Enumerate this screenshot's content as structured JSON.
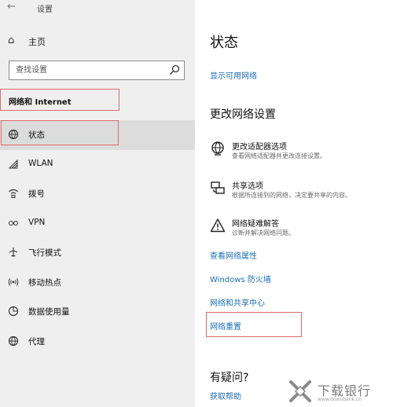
{
  "window": {
    "back_glyph": "←",
    "title": "设置"
  },
  "sidebar": {
    "home": {
      "icon": "home-icon",
      "label": "主页"
    },
    "search": {
      "placeholder": "查找设置",
      "icon": "search-icon"
    },
    "section_title": "网络和 Internet",
    "items": [
      {
        "icon": "status-globe-icon",
        "label": "状态",
        "selected": true
      },
      {
        "icon": "wifi-icon",
        "label": "WLAN"
      },
      {
        "icon": "dialup-icon",
        "label": "拨号"
      },
      {
        "icon": "vpn-icon",
        "label": "VPN"
      },
      {
        "icon": "airplane-icon",
        "label": "飞行模式"
      },
      {
        "icon": "hotspot-icon",
        "label": "移动热点"
      },
      {
        "icon": "data-usage-icon",
        "label": "数据使用量"
      },
      {
        "icon": "proxy-globe-icon",
        "label": "代理"
      }
    ]
  },
  "main": {
    "title": "状态",
    "show_networks_link": "显示可用网络",
    "change_heading": "更改网络设置",
    "options": [
      {
        "icon": "adapter-globe-icon",
        "title": "更改适配器选项",
        "desc": "查看网络适配器并更改连接设置。"
      },
      {
        "icon": "sharing-icon",
        "title": "共享选项",
        "desc": "根据所连接到的网络，决定要共享的内容。"
      },
      {
        "icon": "warning-icon",
        "title": "网络疑难解答",
        "desc": "诊断并解决网络问题。"
      }
    ],
    "links": {
      "properties": "查看网络属性",
      "firewall": "Windows 防火墙",
      "sharing_center": "网络和共享中心",
      "reset": "网络重置"
    },
    "question_heading": "有疑问?",
    "help_link": "获取帮助"
  },
  "watermark": {
    "text": "下载银行",
    "url": "www.downbank.cn"
  },
  "colors": {
    "link": "#1a6fb5",
    "highlight_box": "#e06a6a",
    "sidebar_bg": "#efefef",
    "selected_bg": "#dcdcdc"
  }
}
